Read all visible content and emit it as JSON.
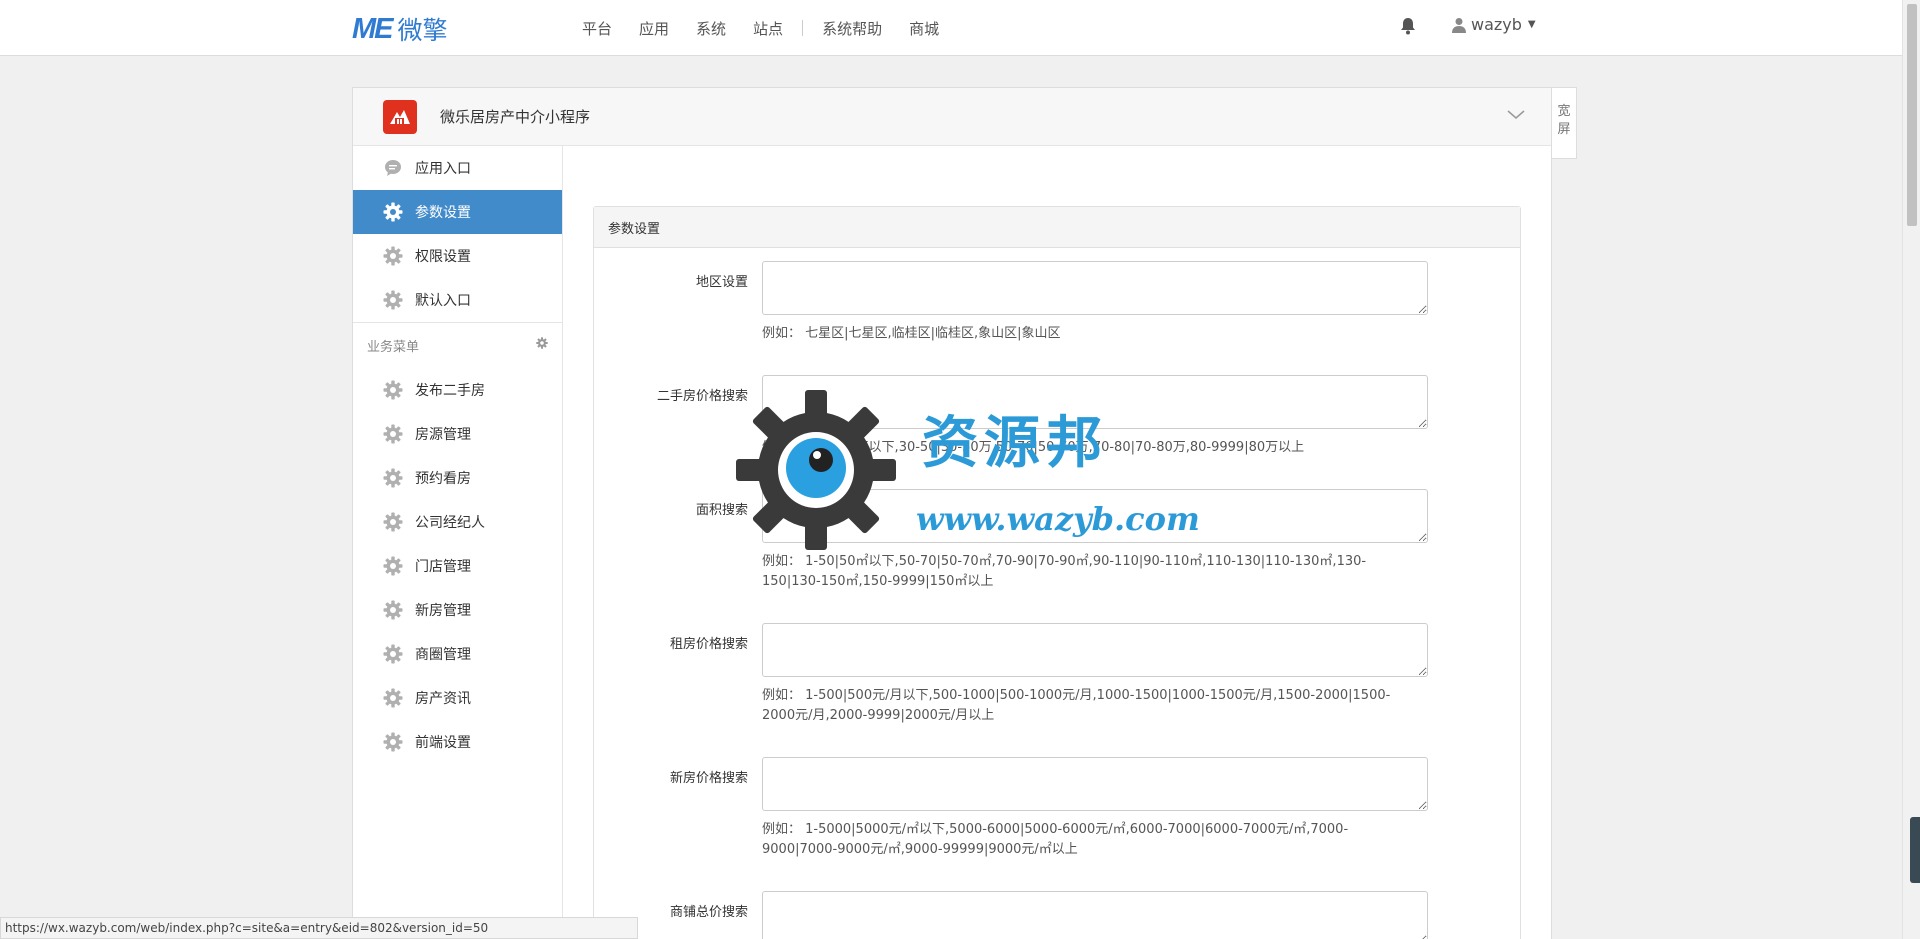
{
  "header": {
    "logo_me": "ME",
    "logo_cn": "微擎",
    "nav": [
      "平台",
      "应用",
      "系统",
      "站点",
      "系统帮助",
      "商城"
    ],
    "username": "wazyb"
  },
  "app": {
    "title": "微乐居房产中介小程序",
    "wide_label": "宽屏"
  },
  "sidebar": {
    "top_items": [
      {
        "label": "应用入口",
        "icon": "chat-icon"
      },
      {
        "label": "参数设置",
        "icon": "gear-icon",
        "active": true
      },
      {
        "label": "权限设置",
        "icon": "gear-icon"
      },
      {
        "label": "默认入口",
        "icon": "gear-icon"
      }
    ],
    "group_title": "业务菜单",
    "business_items": [
      "发布二手房",
      "房源管理",
      "预约看房",
      "公司经纪人",
      "门店管理",
      "新房管理",
      "商圈管理",
      "房产资讯",
      "前端设置"
    ]
  },
  "panel": {
    "title": "参数设置",
    "fields": [
      {
        "label": "地区设置",
        "help": "例如：  七星区|七星区,临桂区|临桂区,象山区|象山区"
      },
      {
        "label": "二手房价格搜索",
        "help": "例如：  1-30|30万以下,30-50|30-50万,50-70|50-70万,70-80|70-80万,80-9999|80万以上"
      },
      {
        "label": "面积搜索",
        "help": "例如：  1-50|50㎡以下,50-70|50-70㎡,70-90|70-90㎡,90-110|90-110㎡,110-130|110-130㎡,130-150|130-150㎡,150-9999|150㎡以上"
      },
      {
        "label": "租房价格搜索",
        "help": "例如：  1-500|500元/月以下,500-1000|500-1000元/月,1000-1500|1000-1500元/月,1500-2000|1500-2000元/月,2000-9999|2000元/月以上"
      },
      {
        "label": "新房价格搜索",
        "help": "例如：  1-5000|5000元/㎡以下,5000-6000|5000-6000元/㎡,6000-7000|6000-7000元/㎡,7000-9000|7000-9000元/㎡,9000-99999|9000元/㎡以上"
      },
      {
        "label": "商铺总价搜索",
        "help": ""
      }
    ]
  },
  "watermark": {
    "title": "资源邦",
    "url": "www.wazyb.com"
  },
  "status_url": "https://wx.wazyb.com/web/index.php?c=site&a=entry&eid=802&version_id=50",
  "colors": {
    "accent": "#428bca",
    "logo": "#2f7bd2",
    "app_icon": "#e0301e"
  }
}
